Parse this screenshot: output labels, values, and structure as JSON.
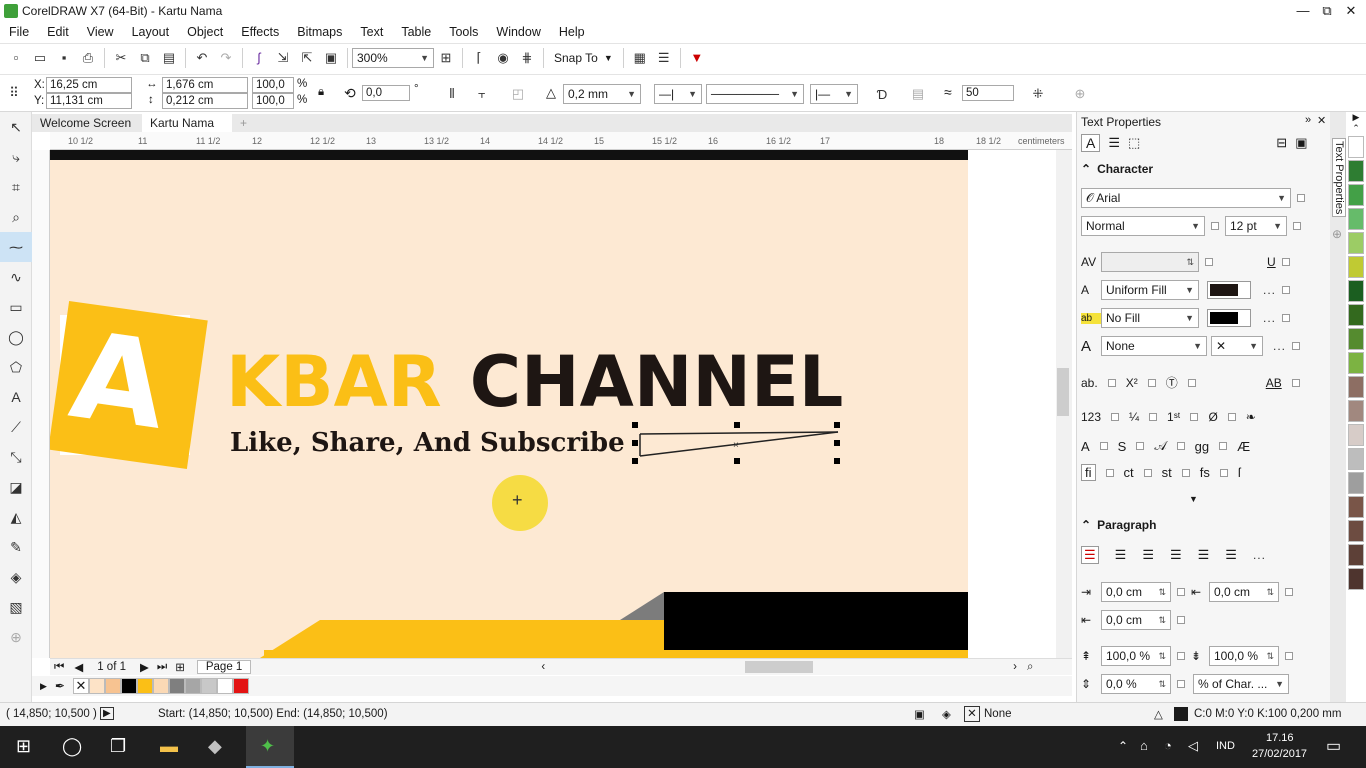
{
  "window": {
    "title": "CorelDRAW X7 (64-Bit) - Kartu Nama",
    "controls": [
      "—",
      "⧉",
      "✕"
    ]
  },
  "menu": [
    "File",
    "Edit",
    "View",
    "Layout",
    "Object",
    "Effects",
    "Bitmaps",
    "Text",
    "Table",
    "Tools",
    "Window",
    "Help"
  ],
  "toolbar": {
    "zoom": "300%",
    "snap_to": "Snap To"
  },
  "propbar": {
    "x_label": "X:",
    "x_value": "16,25 cm",
    "y_label": "Y:",
    "y_value": "11,131 cm",
    "w_value": "1,676 cm",
    "h_value": "0,212 cm",
    "sx_value": "100,0",
    "sy_value": "100,0",
    "pct": "%",
    "angle_value": "0,0",
    "deg": "°",
    "outline_width": "0,2 mm",
    "smoothing_value": "50"
  },
  "doc_tabs": [
    "Welcome Screen",
    "Kartu Nama",
    "+"
  ],
  "ruler": {
    "ticks": [
      "10 1/2",
      "11",
      "11 1/2",
      "12",
      "12 1/2",
      "13",
      "13 1/2",
      "14",
      "14 1/2",
      "15",
      "15 1/2",
      "16",
      "16 1/2",
      "17",
      "18",
      "18 1/2"
    ],
    "unit": "centimeters"
  },
  "card": {
    "logo_letter": "A",
    "brand_first": "KBAR",
    "brand_second": "CHANNEL",
    "tagline": "Like, Share, And Subscribe"
  },
  "pagenav": {
    "page_count": "1 of 1",
    "page_tab": "Page 1"
  },
  "palette_colors": [
    "#fde3c7",
    "#f7c391",
    "#000000",
    "#fbbf16",
    "#fbd9b5",
    "#7f7f7f",
    "#a6a6a6",
    "#c8c8c8",
    "#ffffff",
    "#e31313"
  ],
  "docker": {
    "title": "Text Properties",
    "tab_label": "Text Properties",
    "character": {
      "header": "Character",
      "font": "Arial",
      "style": "Normal",
      "size": "12 pt",
      "fill_type": "Uniform Fill",
      "bg_fill": "No Fill",
      "outline": "None"
    },
    "paragraph": {
      "header": "Paragraph",
      "indent_left": "0,0 cm",
      "indent_right": "0,0 cm",
      "first_line": "0,0 cm",
      "line_spacing": "100,0 %",
      "char_spacing": "100,0 %",
      "before": "0,0 %",
      "unit_select": "% of Char. ..."
    }
  },
  "right_colors": [
    "#ffffff",
    "#2e7d32",
    "#43a047",
    "#66bb6a",
    "#9ccc65",
    "#c0ca33",
    "#1b5e20",
    "#33691e",
    "#558b2f",
    "#7cb342",
    "#8d6e63",
    "#a1887f",
    "#d7ccc8",
    "#bdbdbd",
    "#9e9e9e",
    "#795548",
    "#6d4c41",
    "#5d4037",
    "#4e342e"
  ],
  "status": {
    "coords": "( 14,850; 10,500 )",
    "start_end": "Start: (14,850; 10,500)  End: (14,850; 10,500)",
    "fill": "None",
    "outline": "C:0 M:0 Y:0 K:100  0,200 mm"
  },
  "taskbar": {
    "lang": "IND",
    "time": "17.16",
    "date": "27/02/2017"
  }
}
